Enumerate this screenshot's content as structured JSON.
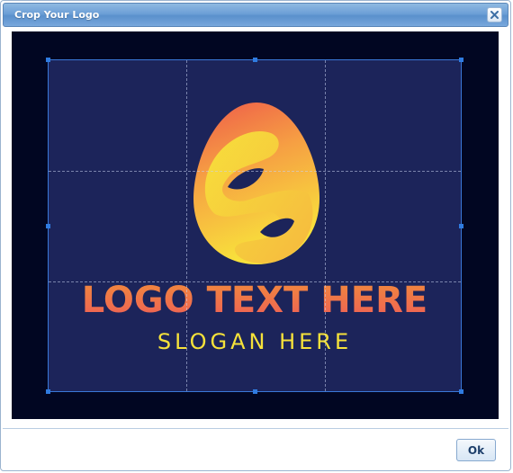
{
  "dialog": {
    "title": "Crop Your Logo",
    "close_icon": "close-icon",
    "ok_label": "Ok"
  },
  "logo": {
    "main_text": "LOGO TEXT HERE",
    "slogan_text": "SLOGAN HERE"
  },
  "colors": {
    "background": "#010622",
    "logo_background": "#1c245a",
    "crop_border": "#3a78d8",
    "main_text_gradient_start": "#f07a3e",
    "main_text_gradient_end": "#f0605a",
    "slogan_color": "#f6e23a",
    "egg_orange": "#f06a4a",
    "egg_yellow": "#f8e23b"
  }
}
